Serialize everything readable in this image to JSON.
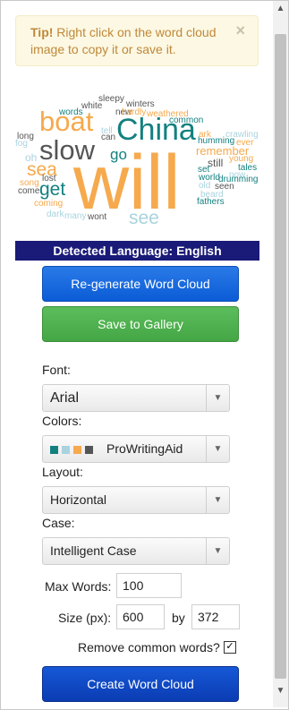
{
  "tip": {
    "bold": "Tip!",
    "text": " Right click on the word cloud image to copy it or save it.",
    "close": "×"
  },
  "word_cloud": [
    {
      "text": "will",
      "color": "#f6a94d"
    },
    {
      "text": "China",
      "color": "#138080"
    },
    {
      "text": "boat",
      "color": "#f6a94d"
    },
    {
      "text": "slow",
      "color": "#555555"
    },
    {
      "text": "sea",
      "color": "#f6a94d"
    },
    {
      "text": "get",
      "color": "#138080"
    },
    {
      "text": "go",
      "color": "#138080"
    },
    {
      "text": "see",
      "color": "#a9d3de"
    },
    {
      "text": "sleepy",
      "color": "#555555"
    },
    {
      "text": "winters",
      "color": "#555555"
    },
    {
      "text": "white",
      "color": "#555555"
    },
    {
      "text": "new",
      "color": "#555555"
    },
    {
      "text": "hardly",
      "color": "#f6a94d"
    },
    {
      "text": "weathered",
      "color": "#f6a94d"
    },
    {
      "text": "words",
      "color": "#138080"
    },
    {
      "text": "common",
      "color": "#138080"
    },
    {
      "text": "long",
      "color": "#555555"
    },
    {
      "text": "fog",
      "color": "#a9d3de"
    },
    {
      "text": "tell",
      "color": "#a9d3de"
    },
    {
      "text": "can",
      "color": "#555555"
    },
    {
      "text": "ark",
      "color": "#f6a94d"
    },
    {
      "text": "crawling",
      "color": "#a9d3de"
    },
    {
      "text": "humming",
      "color": "#138080"
    },
    {
      "text": "ever",
      "color": "#f6a94d"
    },
    {
      "text": "remember",
      "color": "#f6a94d"
    },
    {
      "text": "young",
      "color": "#f6a94d"
    },
    {
      "text": "oh",
      "color": "#a9d3de"
    },
    {
      "text": "still",
      "color": "#555555"
    },
    {
      "text": "set",
      "color": "#138080"
    },
    {
      "text": "tales",
      "color": "#138080"
    },
    {
      "text": "now",
      "color": "#a9d3de"
    },
    {
      "text": "world",
      "color": "#138080"
    },
    {
      "text": "drumming",
      "color": "#138080"
    },
    {
      "text": "song",
      "color": "#f6a94d"
    },
    {
      "text": "lost",
      "color": "#555555"
    },
    {
      "text": "old",
      "color": "#a9d3de"
    },
    {
      "text": "seen",
      "color": "#555555"
    },
    {
      "text": "come",
      "color": "#555555"
    },
    {
      "text": "beard",
      "color": "#a9d3de"
    },
    {
      "text": "coming",
      "color": "#f6a94d"
    },
    {
      "text": "fathers",
      "color": "#138080"
    },
    {
      "text": "dark",
      "color": "#a9d3de"
    },
    {
      "text": "many",
      "color": "#a9d3de"
    },
    {
      "text": "wont",
      "color": "#555555"
    }
  ],
  "language_bar": "Detected Language: English",
  "buttons": {
    "regenerate": "Re-generate Word Cloud",
    "save_gallery": "Save to Gallery",
    "create": "Create Word Cloud"
  },
  "form": {
    "font_label": "Font:",
    "font_value": "Arial",
    "colors_label": "Colors:",
    "colors_value": "ProWritingAid",
    "color_swatches": [
      "#138080",
      "#a9d3de",
      "#f6a94d",
      "#555555"
    ],
    "layout_label": "Layout:",
    "layout_value": "Horizontal",
    "case_label": "Case:",
    "case_value": "Intelligent Case",
    "max_words_label": "Max Words:",
    "max_words_value": "100",
    "size_label": "Size (px):",
    "size_width": "600",
    "size_by": "by",
    "size_height": "372",
    "remove_common_label": "Remove common words?",
    "remove_common_checked": "✓"
  }
}
